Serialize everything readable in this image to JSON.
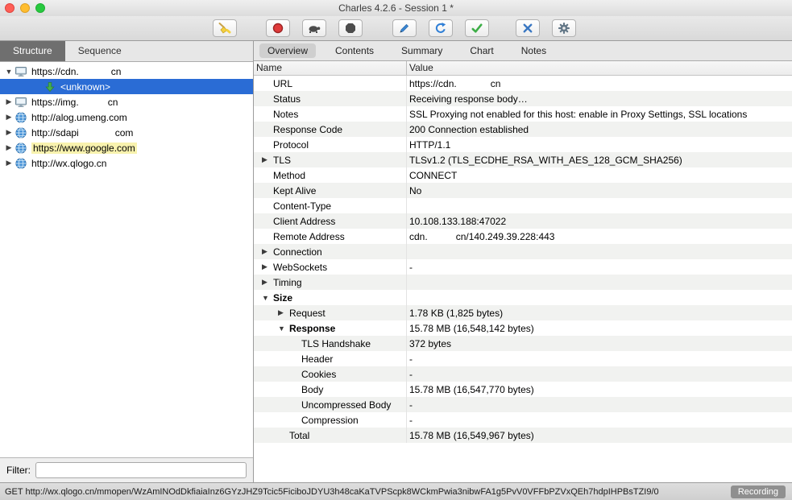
{
  "window": {
    "title": "Charles 4.2.6 - Session 1 *"
  },
  "toolbar": {
    "buttons": [
      {
        "name": "clear-session-button",
        "icon": "broom-icon",
        "group": 1
      },
      {
        "name": "record-button",
        "icon": "record-icon",
        "group": 2
      },
      {
        "name": "throttle-button",
        "icon": "turtle-icon",
        "group": 2
      },
      {
        "name": "breakpoints-button",
        "icon": "breakpoint-icon",
        "group": 2
      },
      {
        "name": "compose-button",
        "icon": "pencil-icon",
        "group": 3
      },
      {
        "name": "repeat-button",
        "icon": "repeat-icon",
        "group": 3
      },
      {
        "name": "validate-button",
        "icon": "check-icon",
        "group": 3
      },
      {
        "name": "tools-button",
        "icon": "tools-icon",
        "group": 4
      },
      {
        "name": "settings-button",
        "icon": "gear-icon",
        "group": 4
      }
    ]
  },
  "sidebar": {
    "tabs": [
      {
        "label": "Structure",
        "active": true
      },
      {
        "label": "Sequence",
        "active": false
      }
    ],
    "tree": [
      {
        "expander": "expanded",
        "icon": "host-icon",
        "parts": [
          {
            "t": "https://cdn."
          },
          {
            "gap": 40
          },
          {
            "t": "cn"
          }
        ]
      },
      {
        "expander": "none",
        "icon": "arrow-down-icon",
        "parts": [
          {
            "t": "<unknown>"
          }
        ],
        "selected": true,
        "child": true
      },
      {
        "expander": "collapsed",
        "icon": "host-icon",
        "parts": [
          {
            "t": "https://img."
          },
          {
            "gap": 36
          },
          {
            "t": "cn"
          }
        ]
      },
      {
        "expander": "collapsed",
        "icon": "globe-icon",
        "parts": [
          {
            "t": "http://alog.umeng.com"
          }
        ]
      },
      {
        "expander": "collapsed",
        "icon": "globe-icon",
        "parts": [
          {
            "t": "http://sdapi"
          },
          {
            "gap": 45
          },
          {
            "t": "com"
          }
        ]
      },
      {
        "expander": "collapsed",
        "icon": "globe-icon",
        "parts": [
          {
            "t": "https://www.google.com"
          }
        ],
        "highlight": true
      },
      {
        "expander": "collapsed",
        "icon": "globe-icon",
        "parts": [
          {
            "t": "http://wx.qlogo.cn"
          }
        ]
      }
    ],
    "filter": {
      "label": "Filter:",
      "value": ""
    }
  },
  "main": {
    "tabs": [
      {
        "label": "Overview",
        "active": true
      },
      {
        "label": "Contents",
        "active": false
      },
      {
        "label": "Summary",
        "active": false
      },
      {
        "label": "Chart",
        "active": false
      },
      {
        "label": "Notes",
        "active": false
      }
    ],
    "columns": [
      "Name",
      "Value"
    ],
    "rows": [
      {
        "name": "URL",
        "level": 0,
        "disclosure": "none",
        "value": [
          {
            "t": "https://cdn."
          },
          {
            "gap": 42
          },
          {
            "t": "cn"
          }
        ]
      },
      {
        "name": "Status",
        "level": 0,
        "disclosure": "none",
        "value": [
          {
            "t": "Receiving response body…"
          }
        ]
      },
      {
        "name": "Notes",
        "level": 0,
        "disclosure": "none",
        "value": [
          {
            "t": "SSL Proxying not enabled for this host: enable in Proxy Settings, SSL locations"
          }
        ]
      },
      {
        "name": "Response Code",
        "level": 0,
        "disclosure": "none",
        "value": [
          {
            "t": "200 Connection established"
          }
        ]
      },
      {
        "name": "Protocol",
        "level": 0,
        "disclosure": "none",
        "value": [
          {
            "t": "HTTP/1.1"
          }
        ]
      },
      {
        "name": "TLS",
        "level": 0,
        "disclosure": "collapsed",
        "value": [
          {
            "t": "TLSv1.2 (TLS_ECDHE_RSA_WITH_AES_128_GCM_SHA256)"
          }
        ]
      },
      {
        "name": "Method",
        "level": 0,
        "disclosure": "none",
        "value": [
          {
            "t": "CONNECT"
          }
        ]
      },
      {
        "name": "Kept Alive",
        "level": 0,
        "disclosure": "none",
        "value": [
          {
            "t": "No"
          }
        ]
      },
      {
        "name": "Content-Type",
        "level": 0,
        "disclosure": "none",
        "value": []
      },
      {
        "name": "Client Address",
        "level": 0,
        "disclosure": "none",
        "value": [
          {
            "t": "10.108.133.188:47022"
          }
        ]
      },
      {
        "name": "Remote Address",
        "level": 0,
        "disclosure": "none",
        "value": [
          {
            "t": "cdn."
          },
          {
            "gap": 35
          },
          {
            "t": "cn/140.249.39.228:443"
          }
        ]
      },
      {
        "name": "Connection",
        "level": 0,
        "disclosure": "collapsed",
        "value": []
      },
      {
        "name": "WebSockets",
        "level": 0,
        "disclosure": "collapsed",
        "value": [
          {
            "t": "-"
          }
        ]
      },
      {
        "name": "Timing",
        "level": 0,
        "disclosure": "collapsed",
        "value": []
      },
      {
        "name": "Size",
        "level": 0,
        "disclosure": "expanded",
        "bold": true,
        "value": []
      },
      {
        "name": "Request",
        "level": 1,
        "disclosure": "collapsed",
        "value": [
          {
            "t": "1.78 KB (1,825 bytes)"
          }
        ]
      },
      {
        "name": "Response",
        "level": 1,
        "disclosure": "expanded",
        "bold": true,
        "value": [
          {
            "t": "15.78 MB (16,548,142 bytes)"
          }
        ]
      },
      {
        "name": "TLS Handshake",
        "level": 2,
        "disclosure": "none",
        "value": [
          {
            "t": "372 bytes"
          }
        ]
      },
      {
        "name": "Header",
        "level": 2,
        "disclosure": "none",
        "value": [
          {
            "t": "-"
          }
        ]
      },
      {
        "name": "Cookies",
        "level": 2,
        "disclosure": "none",
        "value": [
          {
            "t": "-"
          }
        ]
      },
      {
        "name": "Body",
        "level": 2,
        "disclosure": "none",
        "value": [
          {
            "t": "15.78 MB (16,547,770 bytes)"
          }
        ]
      },
      {
        "name": "Uncompressed Body",
        "level": 2,
        "disclosure": "none",
        "value": [
          {
            "t": "-"
          }
        ]
      },
      {
        "name": "Compression",
        "level": 2,
        "disclosure": "none",
        "value": [
          {
            "t": "-"
          }
        ]
      },
      {
        "name": "Total",
        "level": 1,
        "disclosure": "none",
        "value": [
          {
            "t": "15.78 MB (16,549,967 bytes)"
          }
        ]
      }
    ]
  },
  "statusbar": {
    "text": "GET http://wx.qlogo.cn/mmopen/WzAmINOdDkfiaiaInz6GYzJHZ9Tcic5FiciboJDYU3h48caKaTVPScpk8WCkmPwia3nibwFA1g5PvV0VFFbPZVxQEh7hdpIHPBsTZI9/0",
    "badge": "Recording"
  },
  "colors": {
    "selection_blue": "#2a6cd5",
    "highlight_yellow": "#f8f2ae",
    "selected_tab_gray": "#cfcfcf",
    "record_red": "#e03a3a",
    "check_green": "#3dae47",
    "accent_blue": "#2f7fd6"
  }
}
